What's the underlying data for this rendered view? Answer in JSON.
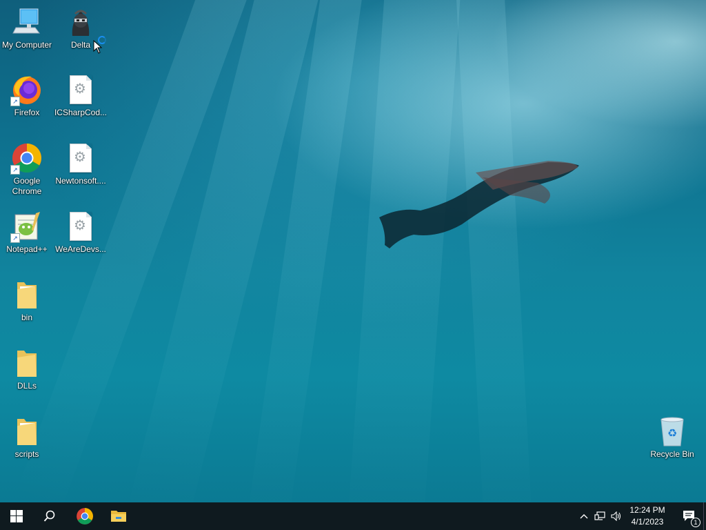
{
  "desktop": {
    "icons": [
      {
        "label": "My Computer",
        "icon": "computer-icon"
      },
      {
        "label": "Delta",
        "icon": "ninja-icon"
      },
      {
        "label": "Firefox",
        "icon": "firefox-icon"
      },
      {
        "label": "ICSharpCod...",
        "icon": "gear-file-icon"
      },
      {
        "label": "Google Chrome",
        "icon": "chrome-icon"
      },
      {
        "label": "Newtonsoft....",
        "icon": "gear-file-icon"
      },
      {
        "label": "Notepad++",
        "icon": "notepad-plus-plus-icon"
      },
      {
        "label": "WeAreDevs...",
        "icon": "gear-file-icon"
      },
      {
        "label": "bin",
        "icon": "folder-icon"
      },
      {
        "label": "DLLs",
        "icon": "folder-icon"
      },
      {
        "label": "scripts",
        "icon": "folder-icon"
      },
      {
        "label": "Recycle Bin",
        "icon": "recycle-bin-icon"
      }
    ]
  },
  "taskbar": {
    "buttons": [
      "start-icon",
      "search-icon",
      "chrome-icon",
      "file-explorer-icon"
    ],
    "tray": {
      "icons": [
        "chevron-up-icon",
        "network-icon",
        "volume-icon"
      ],
      "time": "12:24 PM",
      "date": "4/1/2023",
      "notification_count": "1"
    }
  },
  "colors": {
    "taskbar": "#0f1a1f",
    "water": "#0e6f8d",
    "accent": "#1a8ef0"
  }
}
